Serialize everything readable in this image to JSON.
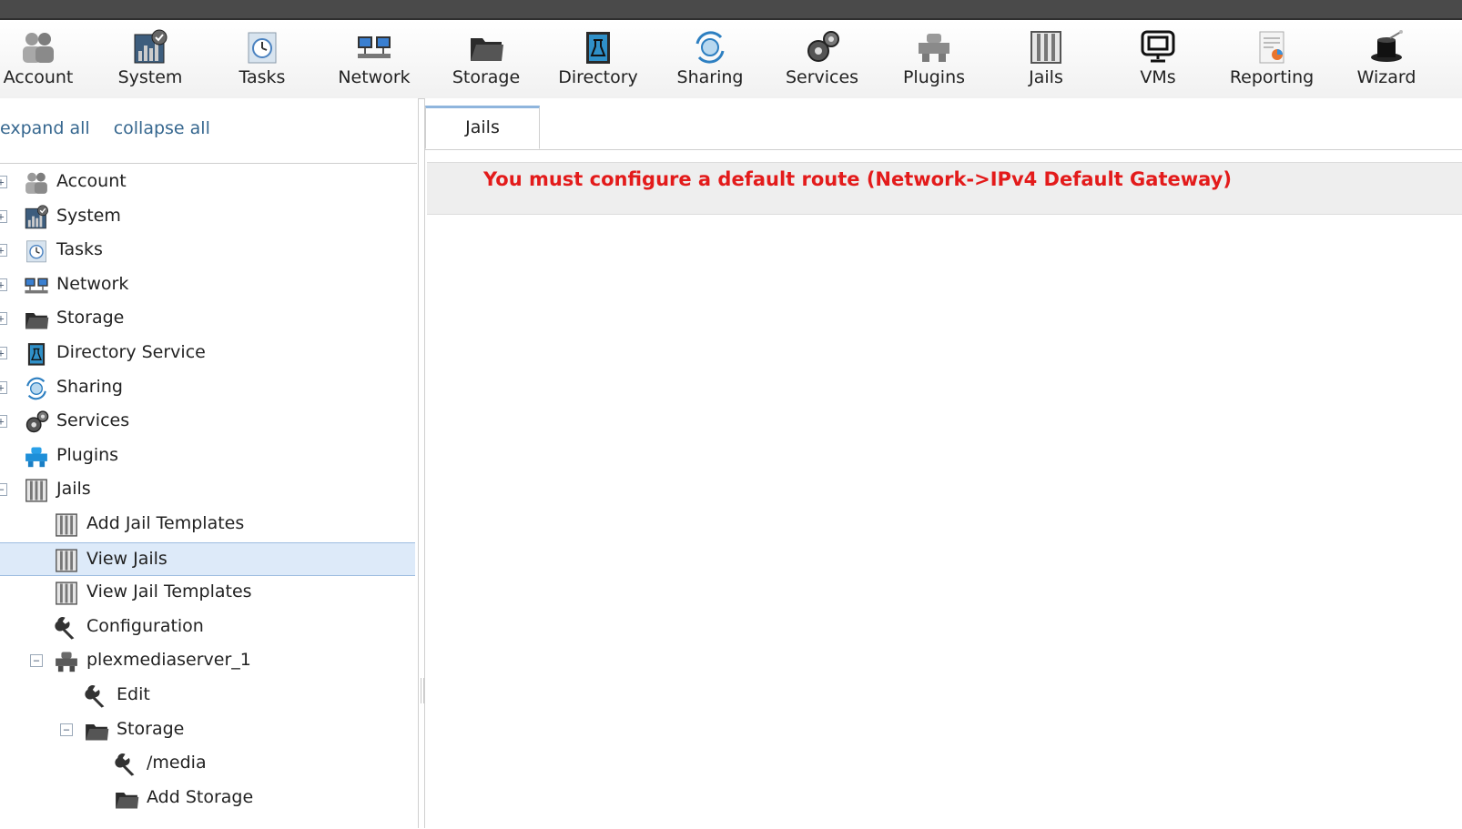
{
  "toolbar": {
    "items": [
      {
        "label": "Account",
        "icon": "account-icon"
      },
      {
        "label": "System",
        "icon": "system-icon"
      },
      {
        "label": "Tasks",
        "icon": "tasks-icon"
      },
      {
        "label": "Network",
        "icon": "network-icon"
      },
      {
        "label": "Storage",
        "icon": "storage-icon"
      },
      {
        "label": "Directory",
        "icon": "directory-icon"
      },
      {
        "label": "Sharing",
        "icon": "sharing-icon"
      },
      {
        "label": "Services",
        "icon": "services-icon"
      },
      {
        "label": "Plugins",
        "icon": "plugins-icon"
      },
      {
        "label": "Jails",
        "icon": "jails-icon"
      },
      {
        "label": "VMs",
        "icon": "vms-icon"
      },
      {
        "label": "Reporting",
        "icon": "reporting-icon"
      },
      {
        "label": "Wizard",
        "icon": "wizard-icon"
      }
    ]
  },
  "sidebar": {
    "expand_all": "expand all",
    "collapse_all": "collapse all",
    "tree": [
      {
        "label": "Account",
        "icon": "account-icon",
        "expander": "+"
      },
      {
        "label": "System",
        "icon": "system-icon",
        "expander": "+"
      },
      {
        "label": "Tasks",
        "icon": "tasks-icon",
        "expander": "+"
      },
      {
        "label": "Network",
        "icon": "network-icon",
        "expander": "+"
      },
      {
        "label": "Storage",
        "icon": "storage-icon",
        "expander": "+"
      },
      {
        "label": "Directory Service",
        "icon": "directory-icon",
        "expander": "+"
      },
      {
        "label": "Sharing",
        "icon": "sharing-icon",
        "expander": "+"
      },
      {
        "label": "Services",
        "icon": "services-icon",
        "expander": "+"
      },
      {
        "label": "Plugins",
        "icon": "plugins-icon",
        "expander": ""
      },
      {
        "label": "Jails",
        "icon": "jails-icon",
        "expander": "−"
      },
      {
        "label": "Add Jail Templates",
        "icon": "jails-icon",
        "expander": ""
      },
      {
        "label": "View Jails",
        "icon": "jails-icon",
        "expander": "",
        "selected": true
      },
      {
        "label": "View Jail Templates",
        "icon": "jails-icon",
        "expander": ""
      },
      {
        "label": "Configuration",
        "icon": "wrench-icon",
        "expander": ""
      },
      {
        "label": "plexmediaserver_1",
        "icon": "plugin-jail-icon",
        "expander": "−"
      },
      {
        "label": "Edit",
        "icon": "wrench-icon",
        "expander": ""
      },
      {
        "label": "Storage",
        "icon": "storage-icon",
        "expander": "−"
      },
      {
        "label": "/media",
        "icon": "wrench-icon",
        "expander": ""
      },
      {
        "label": "Add Storage",
        "icon": "storage-icon",
        "expander": ""
      }
    ]
  },
  "main": {
    "tabs": [
      {
        "label": "Jails"
      }
    ],
    "alert": "You must configure a default route (Network->IPv4 Default Gateway)"
  },
  "colors": {
    "alert_text": "#e31b1b",
    "link": "#36678f",
    "selected_bg": "#ddeaf9"
  }
}
